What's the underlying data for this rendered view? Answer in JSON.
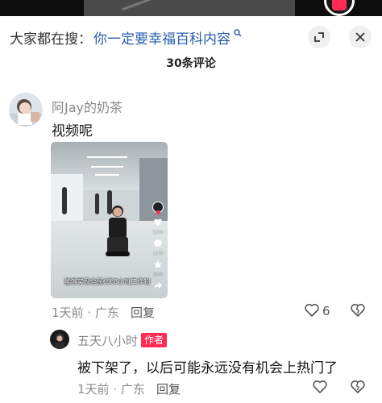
{
  "search": {
    "prefix": "大家都在搜：",
    "query": "你一定要幸福百科内容"
  },
  "comments_header": {
    "count_label": "30条评论"
  },
  "comments": [
    {
      "username": "阿Jay的奶茶",
      "text": "视频呢",
      "video_caption": "能够实现全民6天8小时工作制",
      "video_side_counts": [
        "1270",
        "1170",
        "2660"
      ],
      "time": "1天前",
      "location": "广东",
      "reply_label": "回复",
      "like_count": "6"
    },
    {
      "username": "五天八小时",
      "badge": "作者",
      "text": "被下架了，以后可能永远没有机会上热门了",
      "time": "1天前",
      "location": "广东",
      "reply_label": "回复"
    }
  ],
  "meta_separator": "·",
  "colors": {
    "link_blue": "#2a5db0",
    "author_badge": "#fe2c55",
    "meta_gray": "#8a8a8a"
  },
  "icons": [
    "search-icon",
    "expand-icon",
    "close-icon",
    "heart-icon",
    "broken-heart-icon"
  ]
}
